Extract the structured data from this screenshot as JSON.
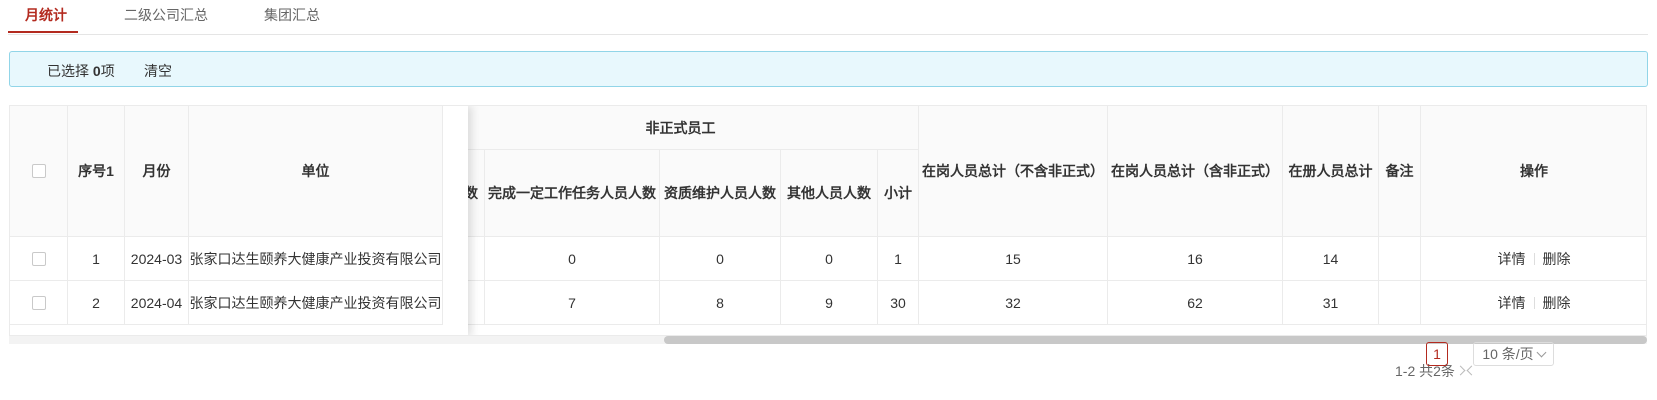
{
  "tabs": [
    {
      "label": "月统计",
      "active": true
    },
    {
      "label": "二级公司汇总",
      "active": false
    },
    {
      "label": "集团汇总",
      "active": false
    }
  ],
  "selection": {
    "prefix": "已选择 ",
    "count": "0",
    "suffix": "项",
    "clear_label": "清空"
  },
  "table": {
    "headers": {
      "index": "序号1",
      "month": "月份",
      "unit": "单位",
      "group_informal": "非正式员工",
      "partial_col": "员人数",
      "task_staff": "完成一定工作任务人员人数",
      "qual_staff": "资质维护人员人数",
      "other_staff": "其他人员人数",
      "subtotal": "小计",
      "on_post_excl": "在岗人员总计（不含非正式）",
      "on_post_incl": "在岗人员总计（含非正式）",
      "registered": "在册人员总计",
      "remark": "备注",
      "actions": "操作"
    },
    "rows": [
      {
        "index": "1",
        "month": "2024-03",
        "unit": "张家口达生颐养大健康产业投资有限公司",
        "task_staff": "0",
        "qual_staff": "0",
        "other_staff": "0",
        "subtotal": "1",
        "on_post_excl": "15",
        "on_post_incl": "16",
        "registered": "14",
        "remark": "",
        "detail": "详情",
        "delete": "删除"
      },
      {
        "index": "2",
        "month": "2024-04",
        "unit": "张家口达生颐养大健康产业投资有限公司",
        "task_staff": "7",
        "qual_staff": "8",
        "other_staff": "9",
        "subtotal": "30",
        "on_post_excl": "32",
        "on_post_incl": "62",
        "registered": "31",
        "remark": "",
        "detail": "详情",
        "delete": "删除"
      }
    ]
  },
  "pagination": {
    "total_text": "1-2 共2条",
    "current_page": "1",
    "page_size": "10 条/页"
  },
  "colors": {
    "accent": "#b32a1f",
    "alert_bg": "#e8f8fd",
    "alert_border": "#91d5e8"
  },
  "icons": {
    "prev": "chevron-left-icon",
    "next": "chevron-right-icon",
    "dropdown": "chevron-down-icon"
  }
}
